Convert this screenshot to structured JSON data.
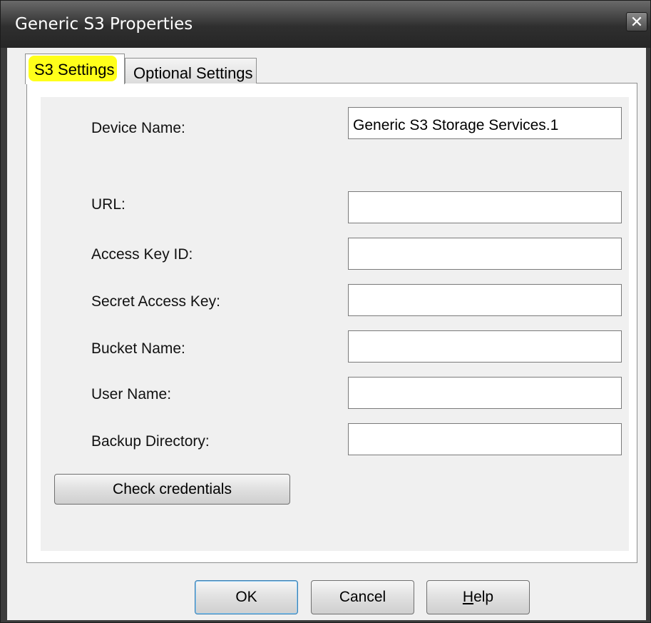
{
  "window": {
    "title": "Generic S3 Properties",
    "close_glyph": "✕"
  },
  "tabs": [
    {
      "label": "S3 Settings",
      "active": true,
      "highlighted": true
    },
    {
      "label": "Optional Settings",
      "active": false
    }
  ],
  "form": {
    "fields": [
      {
        "label": "Device Name:",
        "value": "Generic S3 Storage Services.1"
      },
      {
        "label": "URL:",
        "value": ""
      },
      {
        "label": "Access Key ID:",
        "value": ""
      },
      {
        "label": "Secret Access Key:",
        "value": ""
      },
      {
        "label": "Bucket Name:",
        "value": ""
      },
      {
        "label": "User Name:",
        "value": ""
      },
      {
        "label": "Backup Directory:",
        "value": ""
      }
    ],
    "check_button": "Check credentials"
  },
  "buttons": {
    "ok": "OK",
    "cancel": "Cancel",
    "help_mnemonic": "H",
    "help_rest": "elp"
  },
  "colors": {
    "highlight": "#ffff1a",
    "titlebar": "#2f2f2f",
    "dialog_bg": "#f0f0f0"
  }
}
